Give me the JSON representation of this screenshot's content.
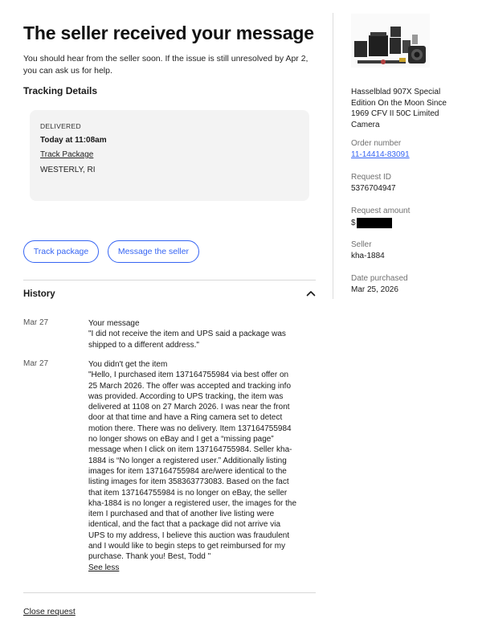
{
  "header": {
    "title": "The seller received your message",
    "subtitle": "You should hear from the seller soon. If the issue is still unresolved by Apr 2, you can ask us for help."
  },
  "tracking": {
    "section_title": "Tracking Details",
    "status": "DELIVERED",
    "time": "Today at 11:08am",
    "link_label": "Track Package",
    "location": "WESTERLY, RI"
  },
  "actions": {
    "track_package": "Track package",
    "message_seller": "Message the seller"
  },
  "history": {
    "title": "History",
    "entries": [
      {
        "date": "Mar 27",
        "title": "Your message",
        "text": "\"I did not receive the item and UPS said a package was shipped to a different address.\""
      },
      {
        "date": "Mar 27",
        "title": "You didn't get the item",
        "text": "\"Hello, I purchased item 137164755984 via best offer on 25 March 2026. The offer was accepted and tracking info was provided. According to UPS tracking, the item was delivered at 1108 on 27 March 2026. I was near the front door at that time and have a Ring camera set to detect motion there. There was no delivery. Item 137164755984 no longer shows on eBay and I get a “missing page” message when I click on item 137164755984. Seller kha-1884 is “No longer a registered user.” Additionally listing images for item 137164755984 are/were identical to the listing images for item 358363773083. Based on the fact that item 137164755984 is no longer on eBay, the seller kha-1884 is no longer a registered user, the images for the item I purchased and that of another live listing were identical, and the fact that a package did not arrive via UPS to my address, I believe this auction was fraudulent and I would like to begin steps to get reimbursed for my purchase. Thank you! Best, Todd \"",
        "toggle": "See less"
      }
    ]
  },
  "footer": {
    "close_request": "Close request"
  },
  "sidebar": {
    "product_name": "Hasselblad 907X Special Edition On the Moon Since 1969 CFV II 50C Limited Camera",
    "order_number_label": "Order number",
    "order_number": "11-14414-83091",
    "request_id_label": "Request ID",
    "request_id": "5376704947",
    "request_amount_label": "Request amount",
    "request_amount_prefix": "$",
    "seller_label": "Seller",
    "seller": "kha-1884",
    "date_purchased_label": "Date purchased",
    "date_purchased": "Mar 25, 2026"
  },
  "colors": {
    "accent": "#3665f3",
    "card_bg": "#f3f3f3",
    "redaction": "#000000"
  }
}
